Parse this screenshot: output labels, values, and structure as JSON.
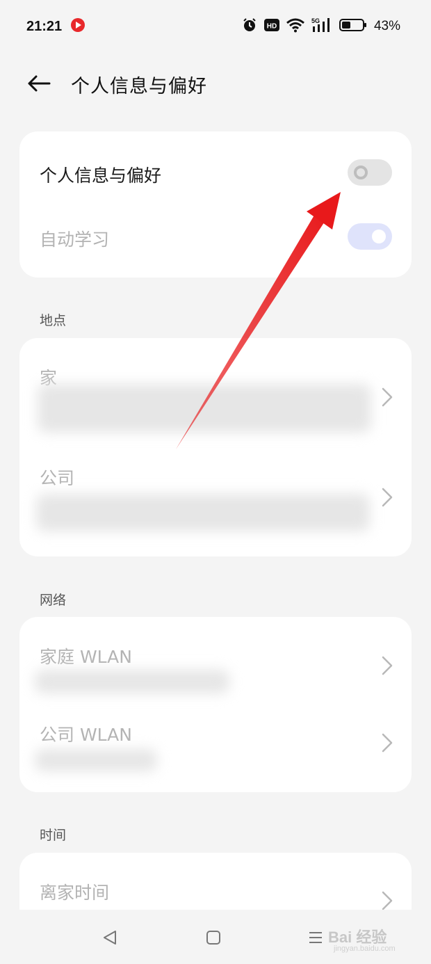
{
  "status_bar": {
    "time": "21:21",
    "battery_percent": "43%",
    "battery_level": 0.43,
    "network_label": "5G",
    "icons": [
      "record-icon",
      "alarm-icon",
      "hd-icon",
      "wifi-icon",
      "signal-icon",
      "battery-icon"
    ]
  },
  "header": {
    "title": "个人信息与偏好"
  },
  "prefs_card": {
    "main_toggle_label": "个人信息与偏好",
    "main_toggle_on": false,
    "auto_learn_label": "自动学习",
    "auto_learn_on": true
  },
  "location_section": {
    "title": "地点",
    "items": [
      {
        "label": "家"
      },
      {
        "label": "公司"
      }
    ]
  },
  "network_section": {
    "title": "网络",
    "items": [
      {
        "label": "家庭 WLAN"
      },
      {
        "label": "公司 WLAN"
      }
    ]
  },
  "time_section": {
    "title": "时间",
    "items": [
      {
        "label": "离家时间"
      }
    ]
  },
  "watermark": {
    "text": "Bai 经验",
    "sub": "jingyan.baidu.com"
  },
  "colors": {
    "background": "#f4f4f4",
    "card": "#ffffff",
    "toggle_on": "#dfe3fb",
    "toggle_off": "#e4e4e4",
    "arrow": "#e8191b"
  }
}
